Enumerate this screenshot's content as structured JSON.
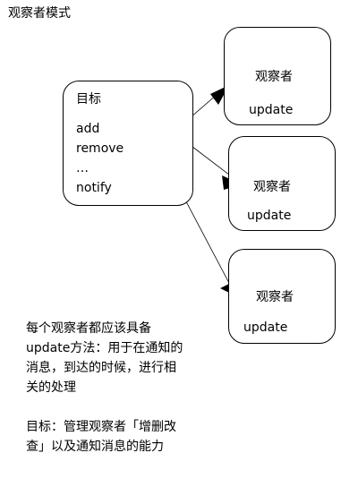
{
  "title": "观察者模式",
  "subject": {
    "title": "目标",
    "methods": [
      "add",
      "remove",
      "…",
      "notify"
    ]
  },
  "observers": [
    {
      "title": "观察者",
      "method": "update"
    },
    {
      "title": "观察者",
      "method": "update"
    },
    {
      "title": "观察者",
      "method": "update"
    }
  ],
  "notes": [
    {
      "lines": [
        "每个观察者都应该具备",
        "update方法：用于在通知的",
        "消息，到达的时候，进行相",
        "关的处理"
      ]
    },
    {
      "lines": [
        "目标：管理观察者「增删改",
        "查」以及通知消息的能力"
      ]
    }
  ]
}
